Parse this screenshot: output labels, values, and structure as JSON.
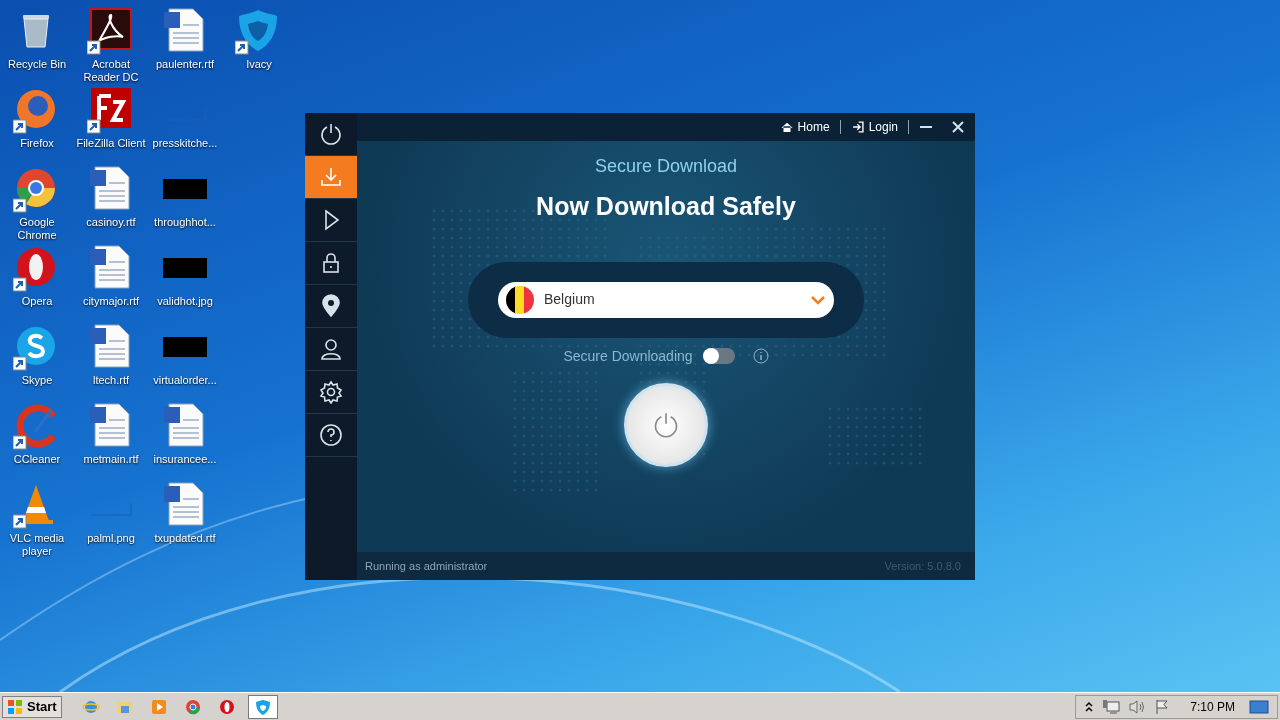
{
  "desktop_icons": [
    {
      "label": "Recycle Bin",
      "kind": "recycle",
      "shortcut": false
    },
    {
      "label": "Firefox",
      "kind": "firefox",
      "shortcut": true
    },
    {
      "label": "Google Chrome",
      "kind": "chrome",
      "shortcut": true
    },
    {
      "label": "Opera",
      "kind": "opera",
      "shortcut": true
    },
    {
      "label": "Skype",
      "kind": "skype",
      "shortcut": true
    },
    {
      "label": "CCleaner",
      "kind": "ccleaner",
      "shortcut": true
    },
    {
      "label": "VLC media player",
      "kind": "vlc",
      "shortcut": true
    },
    {
      "label": "Acrobat Reader DC",
      "kind": "acrobat",
      "shortcut": true
    },
    {
      "label": "FileZilla Client",
      "kind": "filezilla",
      "shortcut": true
    },
    {
      "label": "casinoy.rtf",
      "kind": "document",
      "shortcut": false
    },
    {
      "label": "citymajor.rtf",
      "kind": "document",
      "shortcut": false
    },
    {
      "label": "ltech.rtf",
      "kind": "document",
      "shortcut": false
    },
    {
      "label": "metmain.rtf",
      "kind": "document",
      "shortcut": false
    },
    {
      "label": "palml.png",
      "kind": "thumbnail",
      "shortcut": false
    },
    {
      "label": "paulenter.rtf",
      "kind": "document",
      "shortcut": false
    },
    {
      "label": "presskitche...",
      "kind": "thumbnail",
      "shortcut": false
    },
    {
      "label": "throughhot...",
      "kind": "black",
      "shortcut": false
    },
    {
      "label": "validhot.jpg",
      "kind": "black",
      "shortcut": false
    },
    {
      "label": "virtualorder...",
      "kind": "black",
      "shortcut": false
    },
    {
      "label": "insurancee...",
      "kind": "document",
      "shortcut": false
    },
    {
      "label": "txupdated.rtf",
      "kind": "document",
      "shortcut": false
    },
    {
      "label": "Ivacy",
      "kind": "shield",
      "shortcut": true
    }
  ],
  "app": {
    "sidebar": [
      {
        "kind": "power",
        "selected": false
      },
      {
        "kind": "download",
        "selected": true
      },
      {
        "kind": "play",
        "selected": false
      },
      {
        "kind": "lock",
        "selected": false
      },
      {
        "kind": "ip",
        "selected": false
      },
      {
        "kind": "user",
        "selected": false
      },
      {
        "kind": "settings",
        "selected": false
      },
      {
        "kind": "help",
        "selected": false
      }
    ],
    "header_links": [
      {
        "label": "Home",
        "kind": "home"
      },
      {
        "label": "Login",
        "kind": "login"
      }
    ],
    "subtitle": "Secure Download",
    "title": "Now Download Safely",
    "location": {
      "value": "Belgium"
    },
    "secure_downloading": {
      "label": "Secure Downloading",
      "on": false
    },
    "status": "Running as administrator",
    "version": "Version: 5.0.8.0"
  },
  "taskbar": {
    "start": "Start",
    "apps": [
      {
        "kind": "ie",
        "selected": false
      },
      {
        "kind": "folder",
        "selected": false
      },
      {
        "kind": "media",
        "selected": false
      },
      {
        "kind": "chrome",
        "selected": false
      },
      {
        "kind": "opera",
        "selected": false
      },
      {
        "kind": "shield",
        "selected": true
      }
    ],
    "clock": "7:10 PM"
  }
}
